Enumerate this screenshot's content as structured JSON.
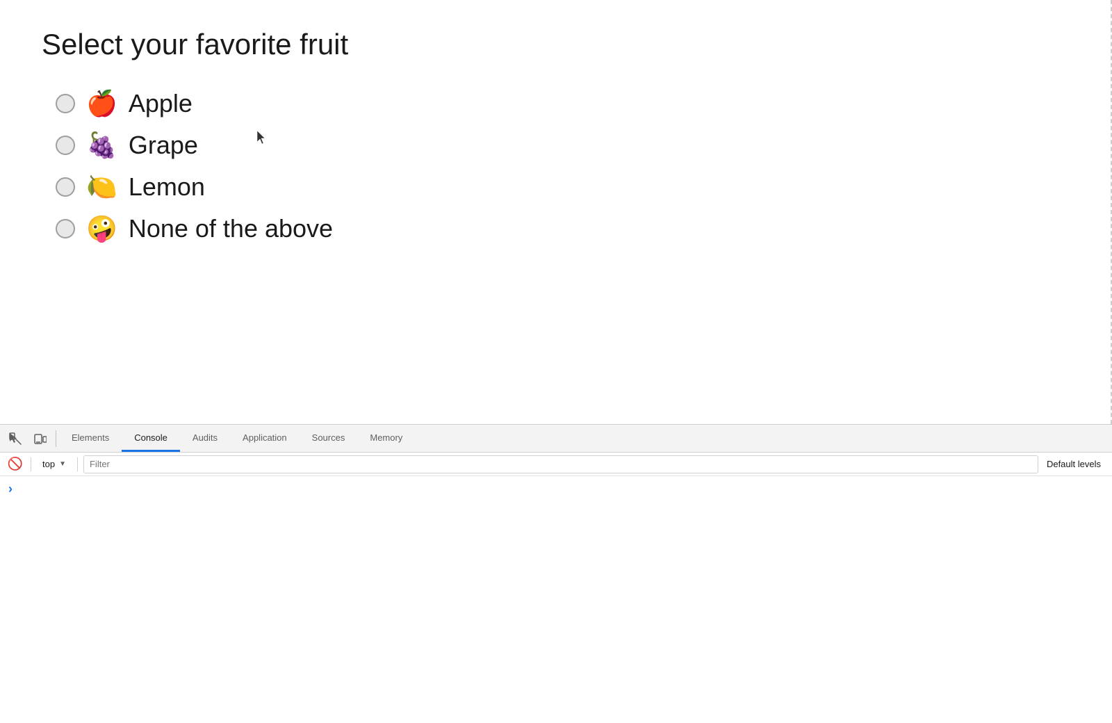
{
  "page": {
    "title": "Select your favorite fruit",
    "fruits": [
      {
        "id": "apple",
        "emoji": "🍎",
        "label": "Apple"
      },
      {
        "id": "grape",
        "emoji": "🍇",
        "label": "Grape"
      },
      {
        "id": "lemon",
        "emoji": "🍋",
        "label": "Lemon"
      },
      {
        "id": "none",
        "emoji": "🤪",
        "label": "None of the above"
      }
    ]
  },
  "devtools": {
    "tabs": [
      {
        "id": "elements",
        "label": "Elements",
        "active": false
      },
      {
        "id": "console",
        "label": "Console",
        "active": true
      },
      {
        "id": "audits",
        "label": "Audits",
        "active": false
      },
      {
        "id": "application",
        "label": "Application",
        "active": false
      },
      {
        "id": "sources",
        "label": "Sources",
        "active": false
      },
      {
        "id": "memory",
        "label": "Memory",
        "active": false
      }
    ],
    "console": {
      "context": "top",
      "filter_placeholder": "Filter",
      "default_levels": "Default levels"
    }
  }
}
